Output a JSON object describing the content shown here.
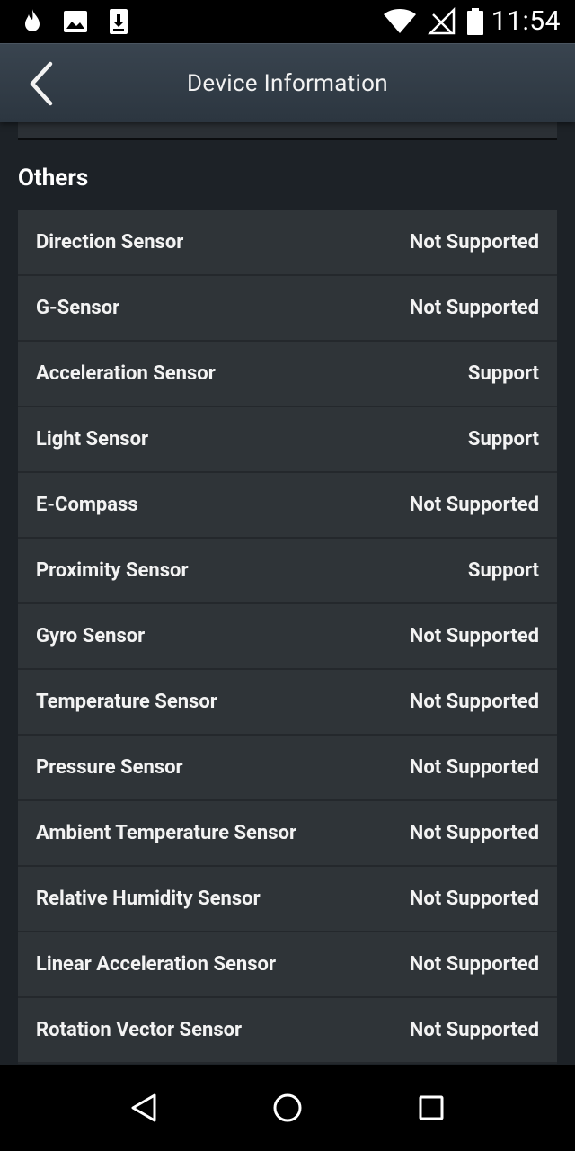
{
  "status_bar": {
    "time": "11:54",
    "icons": [
      "flame-icon",
      "image-icon",
      "download-icon",
      "wifi-icon",
      "no-signal-icon",
      "battery-icon"
    ]
  },
  "header": {
    "title": "Device Information",
    "back_icon": "chevron-left-icon"
  },
  "section": {
    "title": "Others",
    "rows": [
      {
        "label": "Direction Sensor",
        "value": "Not Supported"
      },
      {
        "label": "G-Sensor",
        "value": "Not Supported"
      },
      {
        "label": "Acceleration Sensor",
        "value": "Support"
      },
      {
        "label": "Light Sensor",
        "value": "Support"
      },
      {
        "label": "E-Compass",
        "value": "Not Supported"
      },
      {
        "label": "Proximity Sensor",
        "value": "Support"
      },
      {
        "label": "Gyro Sensor",
        "value": "Not Supported"
      },
      {
        "label": "Temperature Sensor",
        "value": "Not Supported"
      },
      {
        "label": "Pressure Sensor",
        "value": "Not Supported"
      },
      {
        "label": "Ambient Temperature Sensor",
        "value": "Not Supported"
      },
      {
        "label": "Relative Humidity Sensor",
        "value": "Not Supported"
      },
      {
        "label": "Linear Acceleration Sensor",
        "value": "Not Supported"
      },
      {
        "label": "Rotation Vector Sensor",
        "value": "Not Supported"
      }
    ]
  },
  "nav_bar": {
    "icons": [
      "nav-back-icon",
      "nav-home-icon",
      "nav-recents-icon"
    ]
  }
}
